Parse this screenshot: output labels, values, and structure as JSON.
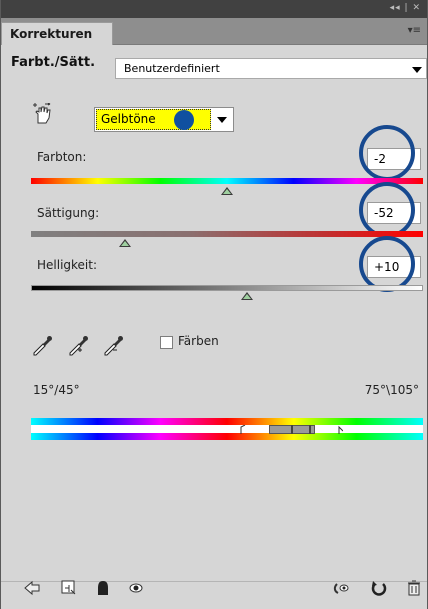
{
  "panel": {
    "tab_label": "Korrekturen"
  },
  "preset": {
    "label": "Farbt./Sätt.",
    "value": "Benutzerdefiniert"
  },
  "channel": {
    "value": "Gelbtöne"
  },
  "sliders": {
    "hue": {
      "label": "Farbton:",
      "value": "-2",
      "thumb_fraction": 0.5
    },
    "saturation": {
      "label": "Sättigung:",
      "value": "-52",
      "thumb_fraction": 0.24
    },
    "lightness": {
      "label": "Helligkeit:",
      "value": "+10",
      "thumb_fraction": 0.55
    }
  },
  "colorize": {
    "label": "Färben",
    "checked": false
  },
  "range": {
    "left_label": "15°/45°",
    "right_label": "75°\\105°"
  },
  "colors": {
    "annotation_blue": "#17498f",
    "channel_highlight": "#ffff00"
  },
  "icons": [
    "hand-target-icon",
    "eyedropper-icon",
    "eyedropper-plus-icon",
    "eyedropper-minus-icon",
    "back-arrow-icon",
    "clip-layer-icon",
    "mask-icon",
    "visibility-eye-icon",
    "previous-state-icon",
    "reset-icon",
    "trash-icon"
  ]
}
